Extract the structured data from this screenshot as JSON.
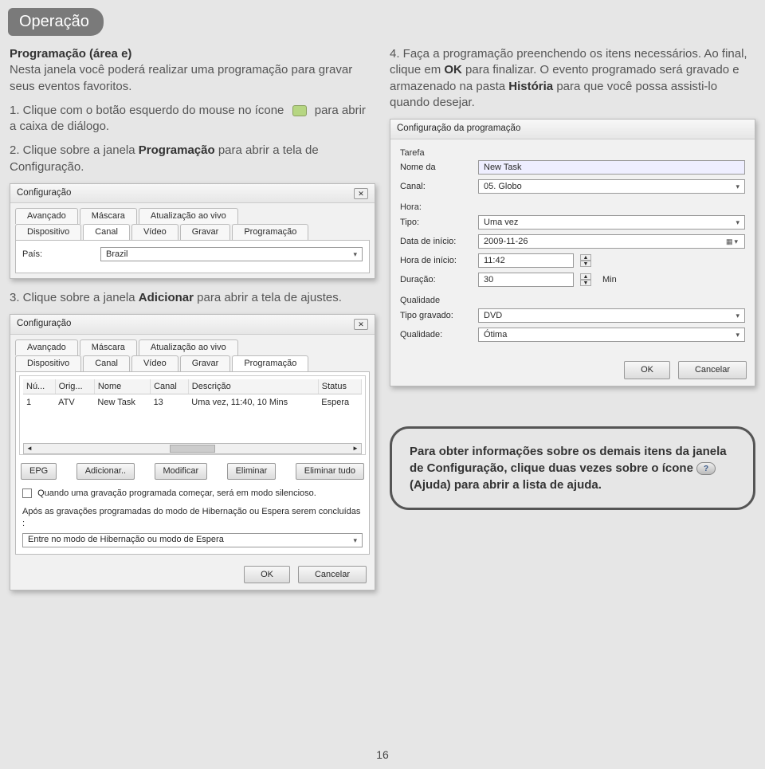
{
  "page_badge": "Operação",
  "page_number": "16",
  "left": {
    "heading": "Programação (área e)",
    "intro": "Nesta janela você poderá realizar uma programação para gravar seus eventos favoritos.",
    "step1_a": "1. Clique com o botão esquerdo do mouse no ícone ",
    "step1_b": " para abrir a caixa de diálogo.",
    "step2_a": "2. Clique sobre a janela ",
    "step2_bold": "Programação",
    "step2_b": " para abrir a tela de Configuração.",
    "step3_a": "3. Clique sobre a janela ",
    "step3_bold": "Adicionar",
    "step3_b": " para abrir a tela de ajustes."
  },
  "right": {
    "step4_a": "4. Faça a programação preenchendo os itens necessários. Ao final, clique em ",
    "step4_bold1": "OK",
    "step4_b": " para finalizar. O evento programado será gravado e armazenado na pasta ",
    "step4_bold2": "História",
    "step4_c": " para que você possa assisti-lo quando desejar."
  },
  "ss1": {
    "title": "Configuração",
    "tabs_top": [
      "Avançado",
      "Máscara",
      "Atualização ao vivo"
    ],
    "tabs_bottom": [
      "Dispositivo",
      "Canal",
      "Vídeo",
      "Gravar",
      "Programação"
    ],
    "field_label": "País:",
    "field_value": "Brazil"
  },
  "ss2": {
    "title": "Configuração",
    "tabs_top": [
      "Avançado",
      "Máscara",
      "Atualização ao vivo"
    ],
    "tabs_bottom": [
      "Dispositivo",
      "Canal",
      "Vídeo",
      "Gravar",
      "Programação"
    ],
    "cols": [
      "Nú...",
      "Orig...",
      "Nome",
      "Canal",
      "Descrição",
      "Status"
    ],
    "row": [
      "1",
      "ATV",
      "New Task",
      "13",
      "Uma vez, 11:40, 10 Mins",
      "Espera"
    ],
    "buttons": [
      "EPG",
      "Adicionar..",
      "Modificar",
      "Eliminar",
      "Eliminar tudo"
    ],
    "check_label": "Quando uma gravação programada começar, será em modo silencioso.",
    "after_label": "Após as gravações programadas do modo de Hibernação ou Espera serem concluídas :",
    "after_value": "Entre no modo de Hibernação ou modo de Espera",
    "ok": "OK",
    "cancel": "Cancelar"
  },
  "ss3": {
    "title": "Configuração da programação",
    "grp_task": "Tarefa",
    "nome_label": "Nome da",
    "nome_value": "New Task",
    "canal_label": "Canal:",
    "canal_value": "05. Globo",
    "grp_hora": "Hora:",
    "tipo_label": "Tipo:",
    "tipo_value": "Uma vez",
    "data_label": "Data de início:",
    "data_value": "2009-11-26",
    "hora_label": "Hora de início:",
    "hora_value": "11:42",
    "dur_label": "Duração:",
    "dur_value": "30",
    "dur_unit": "Min",
    "grp_qual": "Qualidade",
    "tipogravado_label": "Tipo gravado:",
    "tipogravado_value": "DVD",
    "qual_label": "Qualidade:",
    "qual_value": "Ótima",
    "ok": "OK",
    "cancel": "Cancelar"
  },
  "note": {
    "a": "Para obter informações sobre os demais itens da janela de Configuração, clique duas vezes sobre o ícone ",
    "b": " (Ajuda) para abrir a lista de ajuda."
  }
}
